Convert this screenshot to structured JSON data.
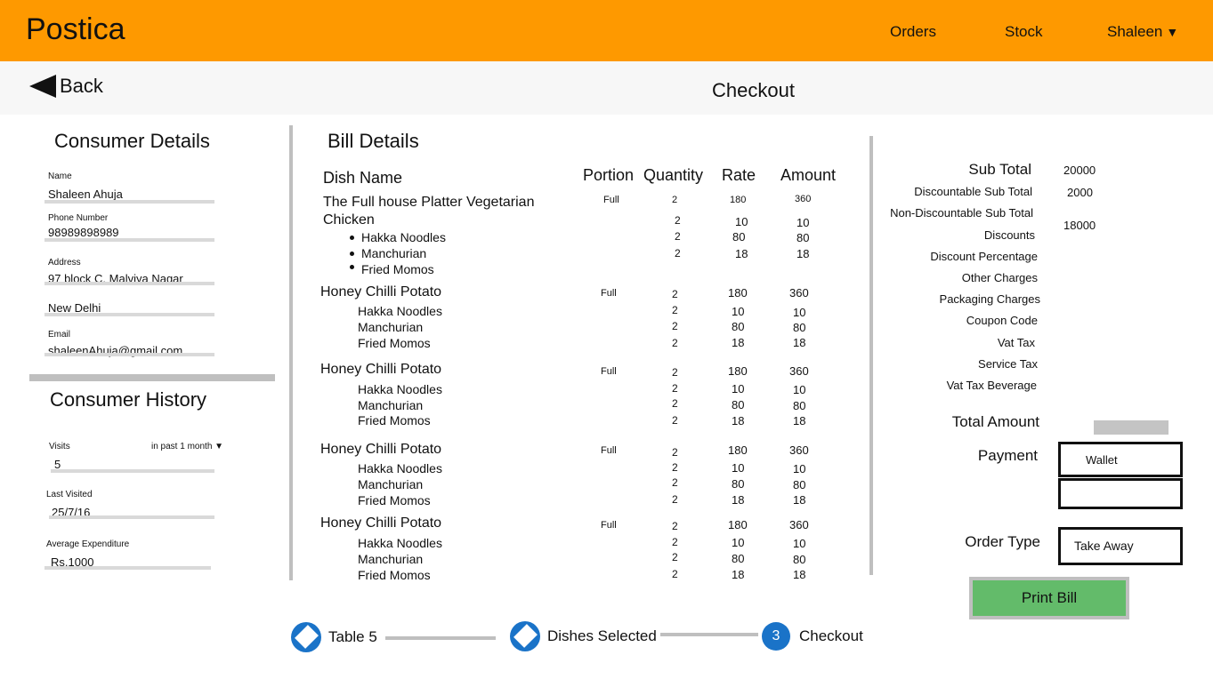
{
  "header": {
    "brand": "Postica",
    "nav": {
      "orders": "Orders",
      "stock": "Stock",
      "user": "Shaleen"
    }
  },
  "subbar": {
    "back": "Back",
    "title": "Checkout"
  },
  "consumer": {
    "title": "Consumer Details",
    "name_label": "Name",
    "name": "Shaleen Ahuja",
    "phone_label": "Phone Number",
    "phone": "98989898989",
    "address_label": "Address",
    "address1": "97 block C, Malviya Nagar",
    "address2": "New Delhi",
    "email_label": "Email",
    "email": "shaleenAhuja@gmail.com"
  },
  "history": {
    "title": "Consumer History",
    "visits_label": "Visits",
    "period": "in past 1 month",
    "visits": "5",
    "last_label": "Last Visited",
    "last": "25/7/16",
    "avg_label": "Average Expenditure",
    "avg": "Rs.1000"
  },
  "bill": {
    "title": "Bill Details",
    "headers": {
      "dish": "Dish Name",
      "portion": "Portion",
      "quantity": "Quantity",
      "rate": "Rate",
      "amount": "Amount"
    },
    "first": {
      "name": "The Full house Platter Vegetarian",
      "portion": "Full",
      "qty": "2",
      "rate": "180",
      "amount": "360",
      "sub_name": "Chicken",
      "sub_qty": "2",
      "sub_rate": "10",
      "sub_amount": "10",
      "items": [
        {
          "name": "Hakka Noodles",
          "qty": "2",
          "rate": "80",
          "amount": "80"
        },
        {
          "name": "Manchurian",
          "qty": "2",
          "rate": "18",
          "amount": "18"
        },
        {
          "name": "Fried Momos"
        }
      ]
    },
    "groups": [
      {
        "name": "Honey Chilli Potato",
        "portion": "Full",
        "qty": "2",
        "rate": "180",
        "amount": "360",
        "items": [
          {
            "name": "Hakka Noodles",
            "qty": "2",
            "rate": "10",
            "amount": "10"
          },
          {
            "name": "Manchurian",
            "qty": "2",
            "rate": "80",
            "amount": "80"
          },
          {
            "name": "Fried Momos",
            "qty": "2",
            "rate": "18",
            "amount": "18"
          }
        ]
      },
      {
        "name": "Honey Chilli Potato",
        "portion": "Full",
        "qty": "2",
        "rate": "180",
        "amount": "360",
        "items": [
          {
            "name": "Hakka Noodles",
            "qty": "2",
            "rate": "10",
            "amount": "10"
          },
          {
            "name": "Manchurian",
            "qty": "2",
            "rate": "80",
            "amount": "80"
          },
          {
            "name": "Fried Momos",
            "qty": "2",
            "rate": "18",
            "amount": "18"
          }
        ]
      },
      {
        "name": "Honey Chilli Potato",
        "portion": "Full",
        "qty": "2",
        "rate": "180",
        "amount": "360",
        "items": [
          {
            "name": "Hakka Noodles",
            "qty": "2",
            "rate": "10",
            "amount": "10"
          },
          {
            "name": "Manchurian",
            "qty": "2",
            "rate": "80",
            "amount": "80"
          },
          {
            "name": "Fried Momos",
            "qty": "2",
            "rate": "18",
            "amount": "18"
          }
        ]
      },
      {
        "name": "Honey Chilli Potato",
        "portion": "Full",
        "qty": "2",
        "rate": "180",
        "amount": "360",
        "items": [
          {
            "name": "Hakka Noodles",
            "qty": "2",
            "rate": "10",
            "amount": "10"
          },
          {
            "name": "Manchurian",
            "qty": "2",
            "rate": "80",
            "amount": "80"
          },
          {
            "name": "Fried Momos",
            "qty": "2",
            "rate": "18",
            "amount": "18"
          }
        ]
      }
    ]
  },
  "summary": {
    "sub_total": "Sub Total",
    "sub_total_val": "20000",
    "disc_sub": "Discountable Sub Total",
    "disc_sub_val": "2000",
    "nondisc_sub": "Non-Discountable Sub Total",
    "nondisc_sub_val": "18000",
    "discounts": "Discounts",
    "disc_pct": "Discount Percentage",
    "other": "Other Charges",
    "packaging": "Packaging Charges",
    "coupon": "Coupon Code",
    "vat": "Vat Tax",
    "service": "Service Tax",
    "vat_bev": "Vat Tax Beverage",
    "total": "Total Amount",
    "payment": "Payment",
    "payment_val": "Wallet",
    "order_type": "Order Type",
    "order_type_val": "Take Away",
    "print": "Print Bill"
  },
  "stepper": {
    "step1": "Table 5",
    "step2": "Dishes Selected",
    "step3_num": "3",
    "step3": "Checkout"
  },
  "colors": {
    "header": "#fe9900",
    "accent": "#1a73c8",
    "print": "#63bb6a"
  },
  "icons": {
    "back": "back-arrow-icon",
    "user_menu": "caret-down-icon",
    "step_done": "check-diamond-icon"
  }
}
